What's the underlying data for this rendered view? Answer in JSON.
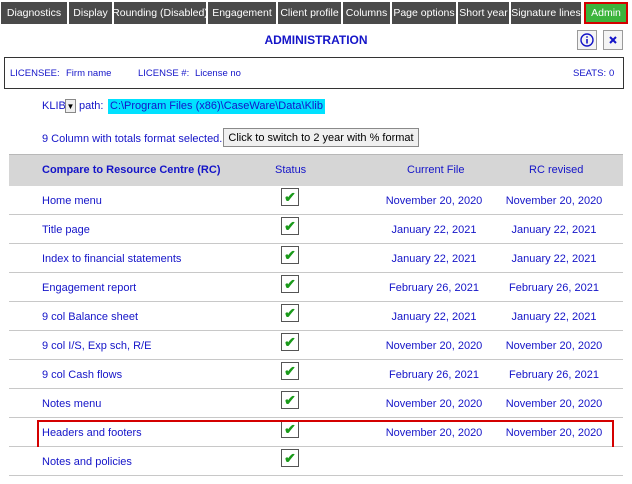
{
  "tabs": [
    {
      "label": "Diagnostics",
      "active": false
    },
    {
      "label": "Display",
      "active": false
    },
    {
      "label": "Rounding (Disabled)",
      "active": false
    },
    {
      "label": "Engagement",
      "active": false
    },
    {
      "label": "Client profile",
      "active": false
    },
    {
      "label": "Columns",
      "active": false
    },
    {
      "label": "Page options",
      "active": false
    },
    {
      "label": "Short year",
      "active": false
    },
    {
      "label": "Signature lines",
      "active": false
    },
    {
      "label": "Admin",
      "active": true
    }
  ],
  "header": {
    "title": "ADMINISTRATION",
    "info_icon": "info-icon",
    "close_icon": "close-icon"
  },
  "licensee": {
    "licensee_label": "LICENSEE:",
    "licensee_value": "Firm name",
    "license_label": "LICENSE #:",
    "license_value": "License no",
    "seats_label": "SEATS:",
    "seats_value": "0"
  },
  "klib": {
    "label": "KLIB",
    "path_label": "path:",
    "path_value": "C:\\Program Files (x86)\\CaseWare\\Data\\Klib"
  },
  "format": {
    "text": "9 Column with totals format selected.",
    "button_label": "Click to switch to 2 year with % format"
  },
  "table": {
    "headers": {
      "compare": "Compare to Resource Centre (RC)",
      "status": "Status",
      "current": "Current File",
      "rc_revised": "RC revised"
    },
    "rows": [
      {
        "name": "Home menu",
        "status": true,
        "current": "November 20, 2020",
        "rc": "November 20, 2020",
        "highlight": false
      },
      {
        "name": "Title page",
        "status": true,
        "current": "January 22, 2021",
        "rc": "January 22, 2021",
        "highlight": false
      },
      {
        "name": "Index to financial statements",
        "status": true,
        "current": "January 22, 2021",
        "rc": "January 22, 2021",
        "highlight": false
      },
      {
        "name": "Engagement report",
        "status": true,
        "current": "February 26, 2021",
        "rc": "February 26, 2021",
        "highlight": false
      },
      {
        "name": "9 col Balance sheet",
        "status": true,
        "current": "January 22, 2021",
        "rc": "January 22, 2021",
        "highlight": false
      },
      {
        "name": "9 col I/S, Exp sch, R/E",
        "status": true,
        "current": "November 20, 2020",
        "rc": "November 20, 2020",
        "highlight": false
      },
      {
        "name": "9 col Cash flows",
        "status": true,
        "current": "February 26, 2021",
        "rc": "February 26, 2021",
        "highlight": false
      },
      {
        "name": "Notes menu",
        "status": true,
        "current": "November 20, 2020",
        "rc": "November 20, 2020",
        "highlight": false
      },
      {
        "name": "Headers and footers",
        "status": true,
        "current": "November 20, 2020",
        "rc": "November 20, 2020",
        "highlight": true
      },
      {
        "name": "Notes and policies",
        "status": true,
        "current": "",
        "rc": "",
        "highlight": false
      }
    ]
  },
  "colors": {
    "accent_text": "#1414c8",
    "tab_bg": "#4a4a4a",
    "tab_active_bg": "#3cb43c",
    "highlight_border": "#d40000",
    "path_bg": "#00e1ff",
    "check_color": "#1a9a1a"
  }
}
